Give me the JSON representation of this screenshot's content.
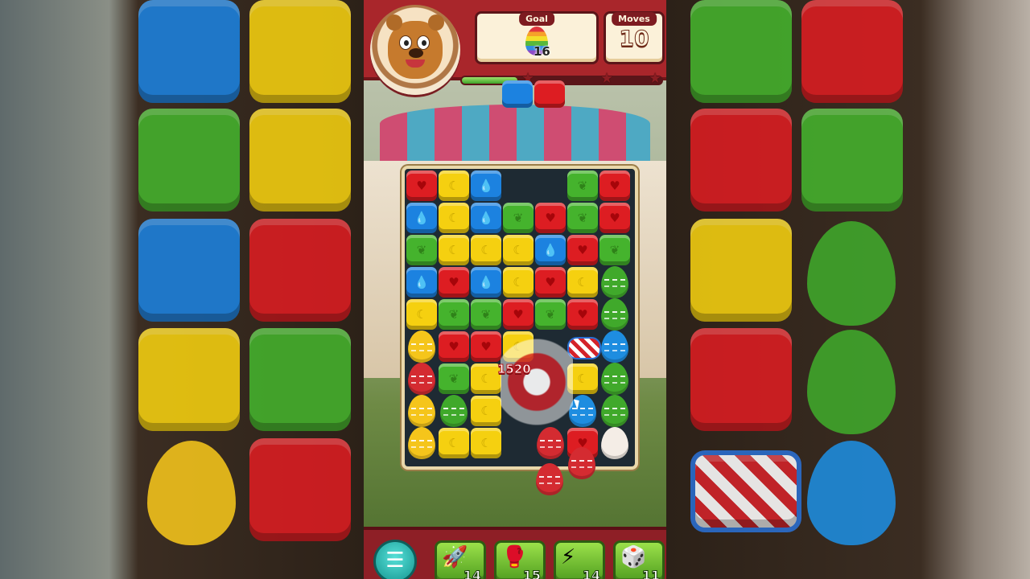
{
  "hud": {
    "goal_label": "Goal",
    "goal_count": "16",
    "goal_icon": "rainbow-egg-icon",
    "moves_label": "Moves",
    "moves_value": "10",
    "progress_fraction": 0.28,
    "stars": 3,
    "avatar": "bear-avatar"
  },
  "board": {
    "columns": 7,
    "rows": 9,
    "score_popup": "1520",
    "special_piece": "rocket-icon",
    "icons": {
      "red": "heart-icon",
      "yellow": "moon-icon",
      "blue": "drop-icon",
      "green": "leaf-icon"
    },
    "glyphs": {
      "red": "♥",
      "yellow": "☾",
      "blue": "💧",
      "green": "❦"
    },
    "spawn_tiles": [
      "blue",
      "red"
    ],
    "grid": [
      [
        "red",
        "yellow",
        "blue",
        null,
        null,
        "green",
        "red"
      ],
      [
        "blue",
        "yellow",
        "blue",
        "green",
        "red",
        "green",
        "red"
      ],
      [
        "green",
        "yellow",
        "yellow",
        "yellow",
        "blue",
        "red",
        "green"
      ],
      [
        "blue",
        "red",
        "blue",
        "yellow",
        "red",
        "yellow",
        "egg-green"
      ],
      [
        "yellow",
        "green",
        "green",
        "red",
        "green",
        "red",
        "egg-green"
      ],
      [
        "egg-yellow",
        "red",
        "red",
        "yellow",
        null,
        "rocket",
        "egg-blue"
      ],
      [
        "egg-red",
        "green",
        "yellow",
        null,
        null,
        "yellow",
        "egg-green"
      ],
      [
        "egg-yellow",
        "egg-green",
        "yellow",
        null,
        null,
        "egg-blue",
        "egg-green"
      ],
      [
        "egg-yellow",
        "yellow",
        "yellow",
        null,
        "egg-red",
        "red",
        "egg-white"
      ]
    ],
    "falling_eggs": [
      "egg-red",
      "egg-red"
    ]
  },
  "boosters": [
    {
      "name": "hammer-rocket-icon",
      "icon": "🚀",
      "count": "14"
    },
    {
      "name": "boxing-glove-icon",
      "icon": "🥊",
      "count": "15"
    },
    {
      "name": "lightning-hammer-icon",
      "icon": "⚡",
      "count": "14"
    },
    {
      "name": "dice-icon",
      "icon": "🎲",
      "count": "11"
    }
  ],
  "menu_icon": "menu-list-icon",
  "colors": {
    "header": "#a9262b",
    "red": "#dd1d22",
    "yellow": "#f5d010",
    "blue": "#1c82e0",
    "green": "#45b32d"
  }
}
